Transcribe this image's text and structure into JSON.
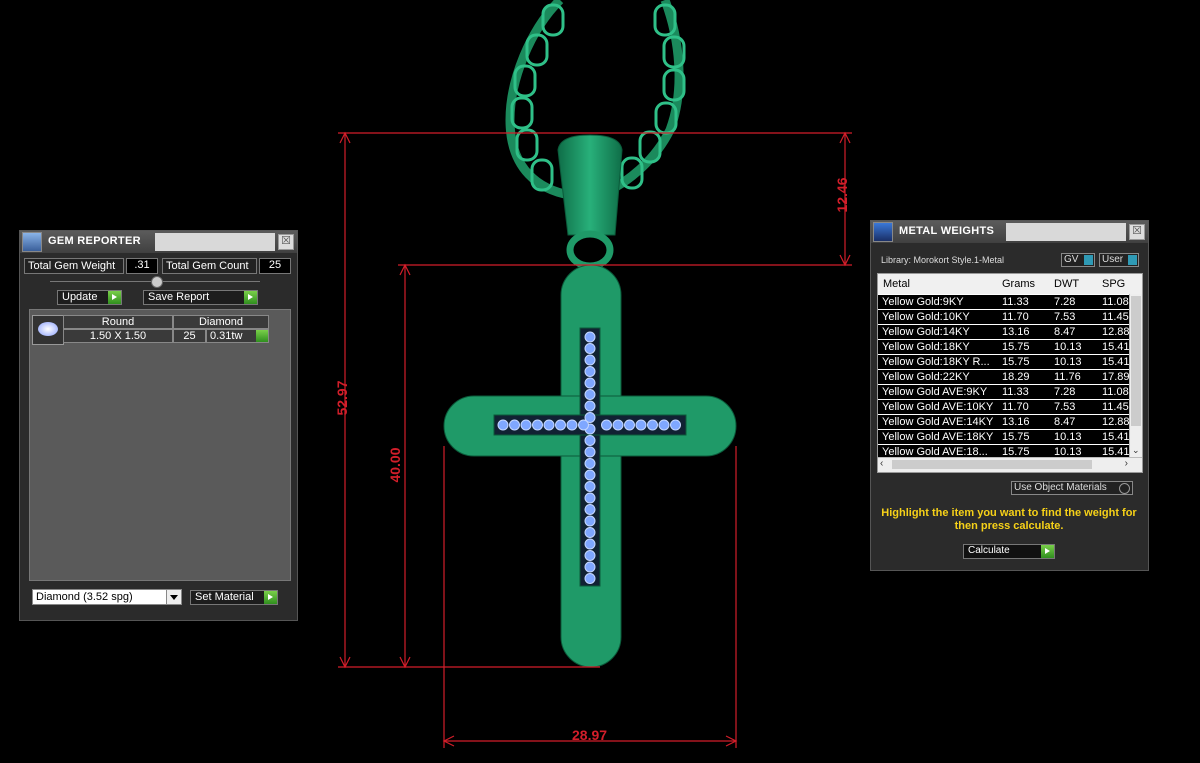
{
  "dimensions": {
    "chain_top": "12.46",
    "overall_height": "52.97",
    "cross_height": "40.00",
    "cross_width": "28.97"
  },
  "colors": {
    "dimension_lines": "#d21e2a",
    "metal": "#1f9a68",
    "gems": "#7fa7ff",
    "hint_text": "#f6d118"
  },
  "gem_reporter": {
    "title": "GEM REPORTER",
    "close": "☒",
    "total_weight_label": "Total Gem Weight",
    "total_weight_value": ".31",
    "total_count_label": "Total Gem Count",
    "total_count_value": "25",
    "update_label": "Update",
    "save_report_label": "Save Report",
    "gem": {
      "shape": "Round",
      "material": "Diamond",
      "size": "1.50 X 1.50",
      "count": "25",
      "weight": "0.31tw"
    },
    "material_select": "Diamond    (3.52 spg)",
    "set_material_label": "Set Material"
  },
  "metal_weights": {
    "title": "METAL WEIGHTS",
    "close": "☒",
    "library": "Library: Morokort Style.1-Metal",
    "gv_label": "GV",
    "user_label": "User",
    "columns": [
      "Metal",
      "Grams",
      "DWT",
      "SPG"
    ],
    "rows": [
      [
        "Yellow Gold:9KY",
        "11.33",
        "7.28",
        "11.08"
      ],
      [
        "Yellow Gold:10KY",
        "11.70",
        "7.53",
        "11.45"
      ],
      [
        "Yellow Gold:14KY",
        "13.16",
        "8.47",
        "12.88"
      ],
      [
        "Yellow Gold:18KY",
        "15.75",
        "10.13",
        "15.41"
      ],
      [
        "Yellow Gold:18KY R...",
        "15.75",
        "10.13",
        "15.41"
      ],
      [
        "Yellow Gold:22KY",
        "18.29",
        "11.76",
        "17.89"
      ],
      [
        "Yellow Gold AVE:9KY",
        "11.33",
        "7.28",
        "11.08"
      ],
      [
        "Yellow Gold AVE:10KY",
        "11.70",
        "7.53",
        "11.45"
      ],
      [
        "Yellow Gold AVE:14KY",
        "13.16",
        "8.47",
        "12.88"
      ],
      [
        "Yellow Gold AVE:18KY",
        "15.75",
        "10.13",
        "15.41"
      ],
      [
        "Yellow Gold AVE:18...",
        "15.75",
        "10.13",
        "15.41"
      ]
    ],
    "use_object_materials": "Use Object Materials",
    "hint": "Highlight the item you want to find the weight for then press calculate.",
    "calculate_label": "Calculate"
  }
}
